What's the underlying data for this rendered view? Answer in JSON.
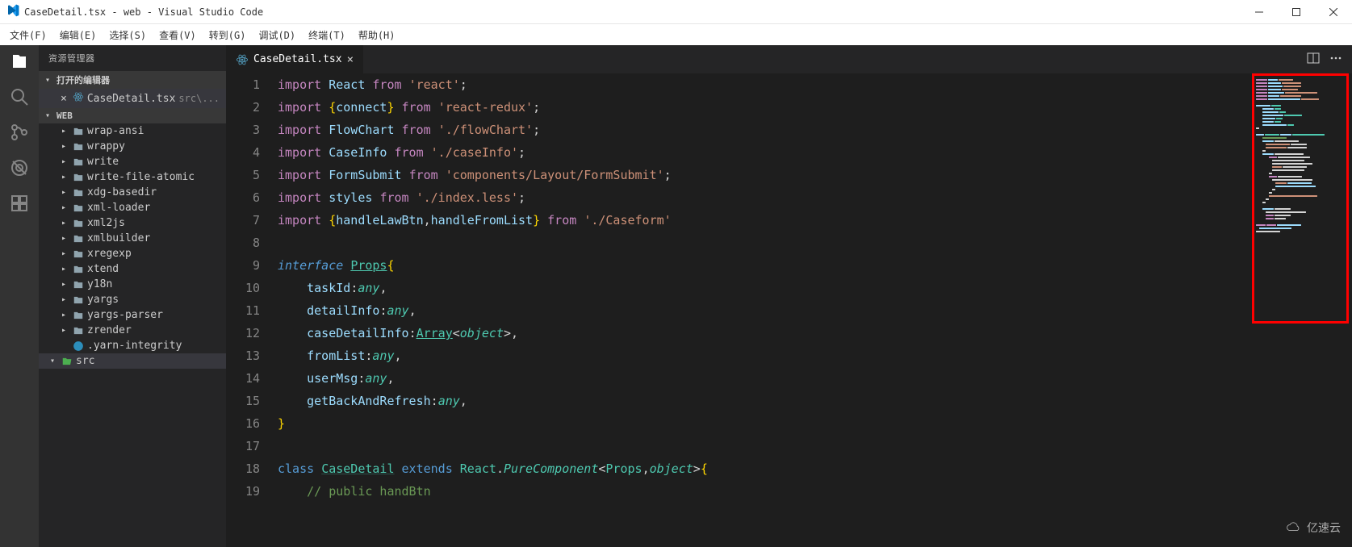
{
  "window": {
    "title": "CaseDetail.tsx - web - Visual Studio Code"
  },
  "menu": {
    "items": [
      "文件(F)",
      "编辑(E)",
      "选择(S)",
      "查看(V)",
      "转到(G)",
      "调试(D)",
      "终端(T)",
      "帮助(H)"
    ]
  },
  "sidebar": {
    "title": "资源管理器",
    "open_editors_label": "打开的编辑器",
    "open_file": {
      "name": "CaseDetail.tsx",
      "path": "src\\..."
    },
    "workspace_label": "WEB",
    "folders": [
      "wrap-ansi",
      "wrappy",
      "write",
      "write-file-atomic",
      "xdg-basedir",
      "xml-loader",
      "xml2js",
      "xmlbuilder",
      "xregexp",
      "xtend",
      "y18n",
      "yargs",
      "yargs-parser",
      "zrender"
    ],
    "yarn_file": ".yarn-integrity",
    "src_folder": "src"
  },
  "tab": {
    "name": "CaseDetail.tsx"
  },
  "code": {
    "lines": [
      "1",
      "2",
      "3",
      "4",
      "5",
      "6",
      "7",
      "8",
      "9",
      "10",
      "11",
      "12",
      "13",
      "14",
      "15",
      "16",
      "17",
      "18",
      "19"
    ],
    "l1": {
      "import": "import",
      "react_u": "React",
      "from": "from",
      "str": "'react'"
    },
    "l2": {
      "import": "import",
      "lb": "{",
      "connect": "connect",
      "rb": "}",
      "from": "from",
      "str": "'react-redux'"
    },
    "l3": {
      "import": "import",
      "flowchart": "FlowChart",
      "from": "from",
      "str": "'./flowChart'"
    },
    "l4": {
      "import": "import",
      "caseinfo": "CaseInfo",
      "from": "from",
      "str": "'./caseInfo'"
    },
    "l5": {
      "import": "import",
      "formsubmit": "FormSubmit",
      "from": "from",
      "str": "'components/Layout/FormSubmit'"
    },
    "l6": {
      "import": "import",
      "styles": "styles",
      "from": "from",
      "str": "'./index.less'"
    },
    "l7": {
      "import": "import",
      "lb": "{",
      "h1": "handleLawBtn",
      "h2": "handleFromList",
      "rb": "}",
      "from": "from",
      "str": "'./Caseform'"
    },
    "l9": {
      "interface": "interface",
      "props": "Props",
      "lb": "{"
    },
    "l10": {
      "prop": "taskId",
      "type": "any"
    },
    "l11": {
      "prop": "detailInfo",
      "type": "any"
    },
    "l12": {
      "prop": "caseDetailInfo",
      "arr": "Array",
      "obj": "object"
    },
    "l13": {
      "prop": "fromList",
      "type": "any"
    },
    "l14": {
      "prop": "userMsg",
      "type": "any"
    },
    "l15": {
      "prop": "getBackAndRefresh",
      "type": "any"
    },
    "l16": {
      "rb": "}"
    },
    "l18": {
      "class": "class",
      "cd": "CaseDetail",
      "extends": "extends",
      "react": "React",
      "pure": "PureComponent",
      "props": "Props",
      "obj": "object",
      "lb": "{"
    },
    "l19": {
      "comment": "// public handBtn"
    }
  },
  "watermark": {
    "text": "亿速云"
  }
}
